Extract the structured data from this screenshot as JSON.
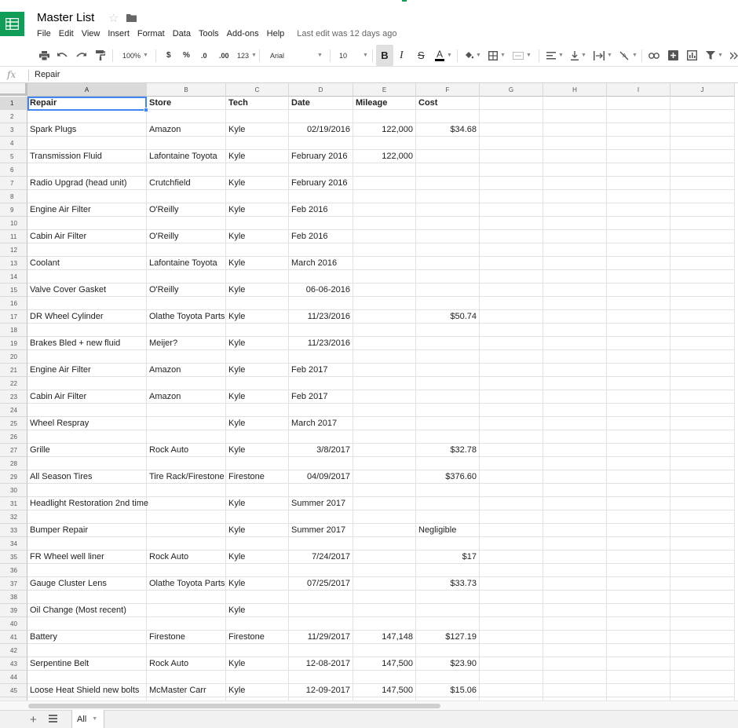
{
  "title": "Master List",
  "menu": [
    "File",
    "Edit",
    "View",
    "Insert",
    "Format",
    "Data",
    "Tools",
    "Add-ons",
    "Help"
  ],
  "last_edit": "Last edit was 12 days ago",
  "toolbar": {
    "zoom": "100%",
    "currency": "$",
    "percent": "%",
    "decrease_decimal": ".0",
    "increase_decimal": ".00",
    "more_formats": "123",
    "font": "Arial",
    "font_size": "10",
    "bold": "B",
    "italic": "I",
    "strike": "S",
    "text_color": "A"
  },
  "formula_bar": {
    "icon": "fx",
    "value": "Repair"
  },
  "columns": [
    "A",
    "B",
    "C",
    "D",
    "E",
    "F",
    "G",
    "H",
    "I",
    "J"
  ],
  "rows": [
    {
      "n": "1",
      "cells": [
        "Repair",
        "Store",
        "Tech",
        "Date",
        "Mileage",
        "Cost",
        "",
        "",
        "",
        ""
      ]
    },
    {
      "n": "2",
      "cells": [
        "",
        "",
        "",
        "",
        "",
        "",
        "",
        "",
        "",
        ""
      ]
    },
    {
      "n": "3",
      "cells": [
        "Spark Plugs",
        "Amazon",
        "Kyle",
        "02/19/2016",
        "122,000",
        "$34.68",
        "",
        "",
        "",
        ""
      ]
    },
    {
      "n": "4",
      "cells": [
        "",
        "",
        "",
        "",
        "",
        "",
        "",
        "",
        "",
        ""
      ]
    },
    {
      "n": "5",
      "cells": [
        "Transmission Fluid",
        "Lafontaine Toyota",
        "Kyle",
        "February 2016",
        "122,000",
        "",
        "",
        "",
        "",
        ""
      ]
    },
    {
      "n": "6",
      "cells": [
        "",
        "",
        "",
        "",
        "",
        "",
        "",
        "",
        "",
        ""
      ]
    },
    {
      "n": "7",
      "cells": [
        "Radio Upgrad (head unit)",
        "Crutchfield",
        "Kyle",
        "February 2016",
        "",
        "",
        "",
        "",
        "",
        ""
      ]
    },
    {
      "n": "8",
      "cells": [
        "",
        "",
        "",
        "",
        "",
        "",
        "",
        "",
        "",
        ""
      ]
    },
    {
      "n": "9",
      "cells": [
        "Engine Air Filter",
        "O'Reilly",
        "Kyle",
        "Feb 2016",
        "",
        "",
        "",
        "",
        "",
        ""
      ]
    },
    {
      "n": "10",
      "cells": [
        "",
        "",
        "",
        "",
        "",
        "",
        "",
        "",
        "",
        ""
      ]
    },
    {
      "n": "11",
      "cells": [
        "Cabin Air Filter",
        "O'Reilly",
        "Kyle",
        "Feb 2016",
        "",
        "",
        "",
        "",
        "",
        ""
      ]
    },
    {
      "n": "12",
      "cells": [
        "",
        "",
        "",
        "",
        "",
        "",
        "",
        "",
        "",
        ""
      ]
    },
    {
      "n": "13",
      "cells": [
        "Coolant",
        "Lafontaine Toyota",
        "Kyle",
        "March 2016",
        "",
        "",
        "",
        "",
        "",
        ""
      ]
    },
    {
      "n": "14",
      "cells": [
        "",
        "",
        "",
        "",
        "",
        "",
        "",
        "",
        "",
        ""
      ]
    },
    {
      "n": "15",
      "cells": [
        "Valve Cover Gasket",
        "O'Reilly",
        "Kyle",
        "06-06-2016",
        "",
        "",
        "",
        "",
        "",
        ""
      ]
    },
    {
      "n": "16",
      "cells": [
        "",
        "",
        "",
        "",
        "",
        "",
        "",
        "",
        "",
        ""
      ]
    },
    {
      "n": "17",
      "cells": [
        "DR Wheel Cylinder",
        "Olathe Toyota Parts",
        "Kyle",
        "11/23/2016",
        "",
        "$50.74",
        "",
        "",
        "",
        ""
      ]
    },
    {
      "n": "18",
      "cells": [
        "",
        "",
        "",
        "",
        "",
        "",
        "",
        "",
        "",
        ""
      ]
    },
    {
      "n": "19",
      "cells": [
        "Brakes Bled + new fluid",
        "Meijer?",
        "Kyle",
        "11/23/2016",
        "",
        "",
        "",
        "",
        "",
        ""
      ]
    },
    {
      "n": "20",
      "cells": [
        "",
        "",
        "",
        "",
        "",
        "",
        "",
        "",
        "",
        ""
      ]
    },
    {
      "n": "21",
      "cells": [
        "Engine Air Filter",
        "Amazon",
        "Kyle",
        "Feb 2017",
        "",
        "",
        "",
        "",
        "",
        ""
      ]
    },
    {
      "n": "22",
      "cells": [
        "",
        "",
        "",
        "",
        "",
        "",
        "",
        "",
        "",
        ""
      ]
    },
    {
      "n": "23",
      "cells": [
        "Cabin Air Filter",
        "Amazon",
        "Kyle",
        "Feb 2017",
        "",
        "",
        "",
        "",
        "",
        ""
      ]
    },
    {
      "n": "24",
      "cells": [
        "",
        "",
        "",
        "",
        "",
        "",
        "",
        "",
        "",
        ""
      ]
    },
    {
      "n": "25",
      "cells": [
        "Wheel Respray",
        "",
        "Kyle",
        "March 2017",
        "",
        "",
        "",
        "",
        "",
        ""
      ]
    },
    {
      "n": "26",
      "cells": [
        "",
        "",
        "",
        "",
        "",
        "",
        "",
        "",
        "",
        ""
      ]
    },
    {
      "n": "27",
      "cells": [
        "Grille",
        "Rock Auto",
        "Kyle",
        "3/8/2017",
        "",
        "$32.78",
        "",
        "",
        "",
        ""
      ]
    },
    {
      "n": "28",
      "cells": [
        "",
        "",
        "",
        "",
        "",
        "",
        "",
        "",
        "",
        ""
      ]
    },
    {
      "n": "29",
      "cells": [
        "All Season Tires",
        "Tire Rack/Firestone",
        "Firestone",
        "04/09/2017",
        "",
        "$376.60",
        "",
        "",
        "",
        ""
      ]
    },
    {
      "n": "30",
      "cells": [
        "",
        "",
        "",
        "",
        "",
        "",
        "",
        "",
        "",
        ""
      ]
    },
    {
      "n": "31",
      "cells": [
        "Headlight Restoration 2nd time",
        "",
        "Kyle",
        "Summer 2017",
        "",
        "",
        "",
        "",
        "",
        ""
      ]
    },
    {
      "n": "32",
      "cells": [
        "",
        "",
        "",
        "",
        "",
        "",
        "",
        "",
        "",
        ""
      ]
    },
    {
      "n": "33",
      "cells": [
        "Bumper Repair",
        "",
        "Kyle",
        "Summer 2017",
        "",
        "Negligible",
        "",
        "",
        "",
        ""
      ]
    },
    {
      "n": "34",
      "cells": [
        "",
        "",
        "",
        "",
        "",
        "",
        "",
        "",
        "",
        ""
      ]
    },
    {
      "n": "35",
      "cells": [
        "FR Wheel well liner",
        "Rock Auto",
        "Kyle",
        "7/24/2017",
        "",
        "$17",
        "",
        "",
        "",
        ""
      ]
    },
    {
      "n": "36",
      "cells": [
        "",
        "",
        "",
        "",
        "",
        "",
        "",
        "",
        "",
        ""
      ]
    },
    {
      "n": "37",
      "cells": [
        "Gauge Cluster Lens",
        "Olathe Toyota Parts",
        "Kyle",
        "07/25/2017",
        "",
        "$33.73",
        "",
        "",
        "",
        ""
      ]
    },
    {
      "n": "38",
      "cells": [
        "",
        "",
        "",
        "",
        "",
        "",
        "",
        "",
        "",
        ""
      ]
    },
    {
      "n": "39",
      "cells": [
        "Oil Change (Most recent)",
        "",
        "Kyle",
        "",
        "",
        "",
        "",
        "",
        "",
        ""
      ]
    },
    {
      "n": "40",
      "cells": [
        "",
        "",
        "",
        "",
        "",
        "",
        "",
        "",
        "",
        ""
      ]
    },
    {
      "n": "41",
      "cells": [
        "Battery",
        "Firestone",
        "Firestone",
        "11/29/2017",
        "147,148",
        "$127.19",
        "",
        "",
        "",
        ""
      ]
    },
    {
      "n": "42",
      "cells": [
        "",
        "",
        "",
        "",
        "",
        "",
        "",
        "",
        "",
        ""
      ]
    },
    {
      "n": "43",
      "cells": [
        "Serpentine Belt",
        "Rock Auto",
        "Kyle",
        "12-08-2017",
        "147,500",
        "$23.90",
        "",
        "",
        "",
        ""
      ]
    },
    {
      "n": "44",
      "cells": [
        "",
        "",
        "",
        "",
        "",
        "",
        "",
        "",
        "",
        ""
      ]
    },
    {
      "n": "45",
      "cells": [
        "Loose Heat Shield new bolts",
        "McMaster Carr",
        "Kyle",
        "12-09-2017",
        "147,500",
        "$15.06",
        "",
        "",
        "",
        ""
      ]
    },
    {
      "n": "46",
      "cells": [
        "",
        "",
        "",
        "",
        "",
        "",
        "",
        "",
        "",
        ""
      ]
    }
  ],
  "sheet_tabs": [
    "All"
  ],
  "colors": {
    "brand_green": "#0f9d58",
    "selection_blue": "#4285f4",
    "header_gray": "#f3f3f3"
  }
}
